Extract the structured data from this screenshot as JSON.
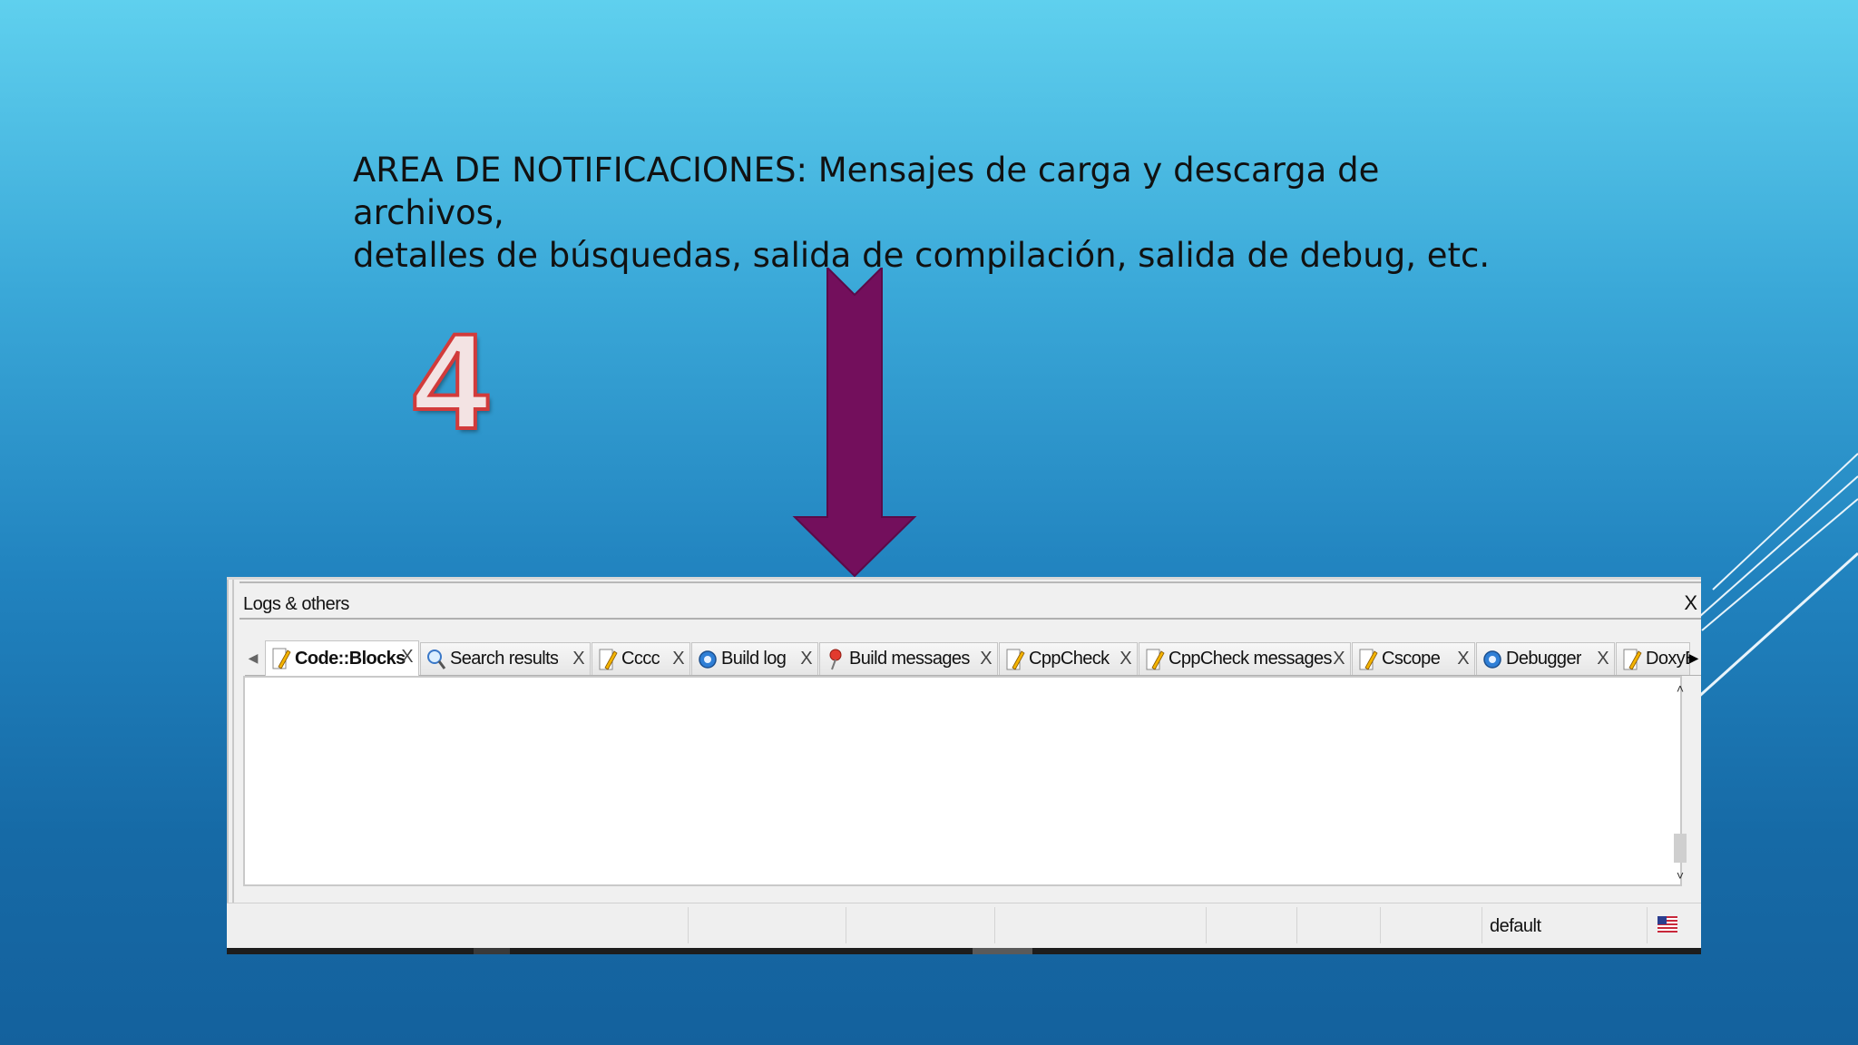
{
  "slide": {
    "heading_line1": "AREA DE NOTIFICACIONES: Mensajes de carga y descarga de archivos,",
    "heading_line2": "detalles de búsquedas, salida de compilación, salida de debug, etc.",
    "step_number": "4",
    "arrow_color": "#730f5c",
    "number_stroke_color": "#d23b3b"
  },
  "panel": {
    "title": "Logs & others",
    "close_label": "X",
    "tabs": [
      {
        "label": "Code::Blocks",
        "icon": "pencil-icon",
        "close": "X",
        "active": true
      },
      {
        "label": "Search results",
        "icon": "magnifier-icon",
        "close": "X",
        "active": false
      },
      {
        "label": "Cccc",
        "icon": "pencil-icon",
        "close": "X",
        "active": false
      },
      {
        "label": "Build log",
        "icon": "gear-icon",
        "close": "X",
        "active": false
      },
      {
        "label": "Build messages",
        "icon": "pin-icon",
        "close": "X",
        "active": false
      },
      {
        "label": "CppCheck",
        "icon": "pencil-icon",
        "close": "X",
        "active": false
      },
      {
        "label": "CppCheck messages",
        "icon": "pencil-icon",
        "close": "X",
        "active": false
      },
      {
        "label": "Cscope",
        "icon": "pencil-icon",
        "close": "X",
        "active": false
      },
      {
        "label": "Debugger",
        "icon": "gear-icon",
        "close": "X",
        "active": false
      },
      {
        "label": "DoxyB",
        "icon": "pencil-icon",
        "close": "",
        "active": false
      }
    ],
    "scroll_up": "˄",
    "scroll_down": "˅",
    "tab_scroll_left": "◀",
    "tab_scroll_right": "▶"
  },
  "statusbar": {
    "encoding_label": "default",
    "flag_icon": "us-flag-icon"
  }
}
